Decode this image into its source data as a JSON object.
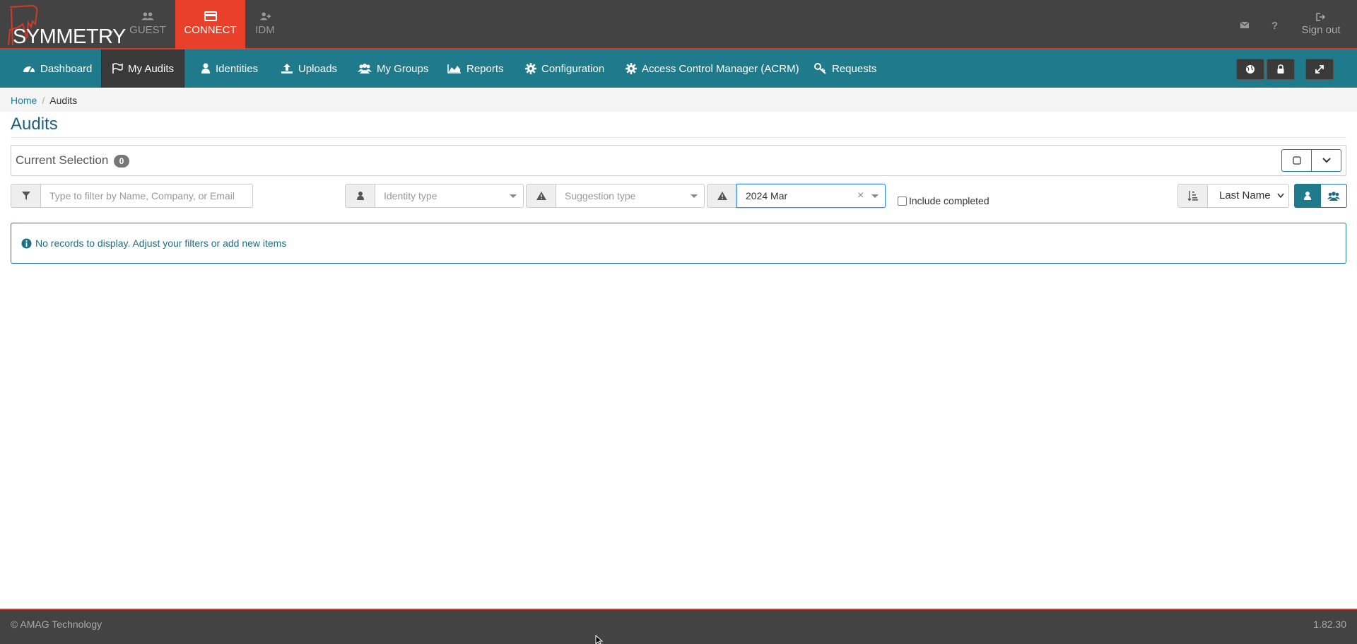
{
  "brand": {
    "logo_text": "SYMMETRY",
    "trademark": "™"
  },
  "app_tabs": [
    {
      "label": "GUEST",
      "icon": "users-icon",
      "active": false
    },
    {
      "label": "CONNECT",
      "icon": "card-icon",
      "active": true
    },
    {
      "label": "IDM",
      "icon": "user-plus-icon",
      "active": false
    }
  ],
  "topbar": {
    "mail_icon": "envelope-icon",
    "help_icon": "question-icon",
    "signout_label": "Sign out"
  },
  "nav": {
    "items": [
      {
        "label": "Dashboard",
        "icon": "dashboard-icon"
      },
      {
        "label": "My Audits",
        "icon": "flag-icon",
        "active": true
      },
      {
        "label": "Identities",
        "icon": "user-icon"
      },
      {
        "label": "Uploads",
        "icon": "upload-icon"
      },
      {
        "label": "My Groups",
        "icon": "users-icon"
      },
      {
        "label": "Reports",
        "icon": "area-chart-icon"
      },
      {
        "label": "Configuration",
        "icon": "gear-icon"
      },
      {
        "label": "Access Control Manager (ACRM)",
        "icon": "gear-icon"
      },
      {
        "label": "Requests",
        "icon": "key-icon"
      }
    ],
    "right_buttons": [
      "globe-icon",
      "lock-icon",
      "expand-icon"
    ]
  },
  "breadcrumb": {
    "home": "Home",
    "separator": "/",
    "current": "Audits"
  },
  "page": {
    "title": "Audits"
  },
  "current_selection": {
    "label": "Current Selection",
    "count": "0"
  },
  "filters": {
    "search_placeholder": "Type to filter by Name, Company, or Email",
    "identity_type_placeholder": "Identity type",
    "suggestion_type_placeholder": "Suggestion type",
    "period_value": "2024 Mar",
    "clear_symbol": "×",
    "include_completed_label": "Include completed",
    "include_completed_checked": false,
    "sort_value": "Last Name"
  },
  "alert": {
    "message": "No records to display. Adjust your filters or add new items"
  },
  "footer": {
    "copyright": "© AMAG Technology",
    "version": "1.82.30"
  },
  "colors": {
    "accent": "#1f7a8c",
    "topbar": "#434343",
    "connect_active": "#e8402b"
  }
}
